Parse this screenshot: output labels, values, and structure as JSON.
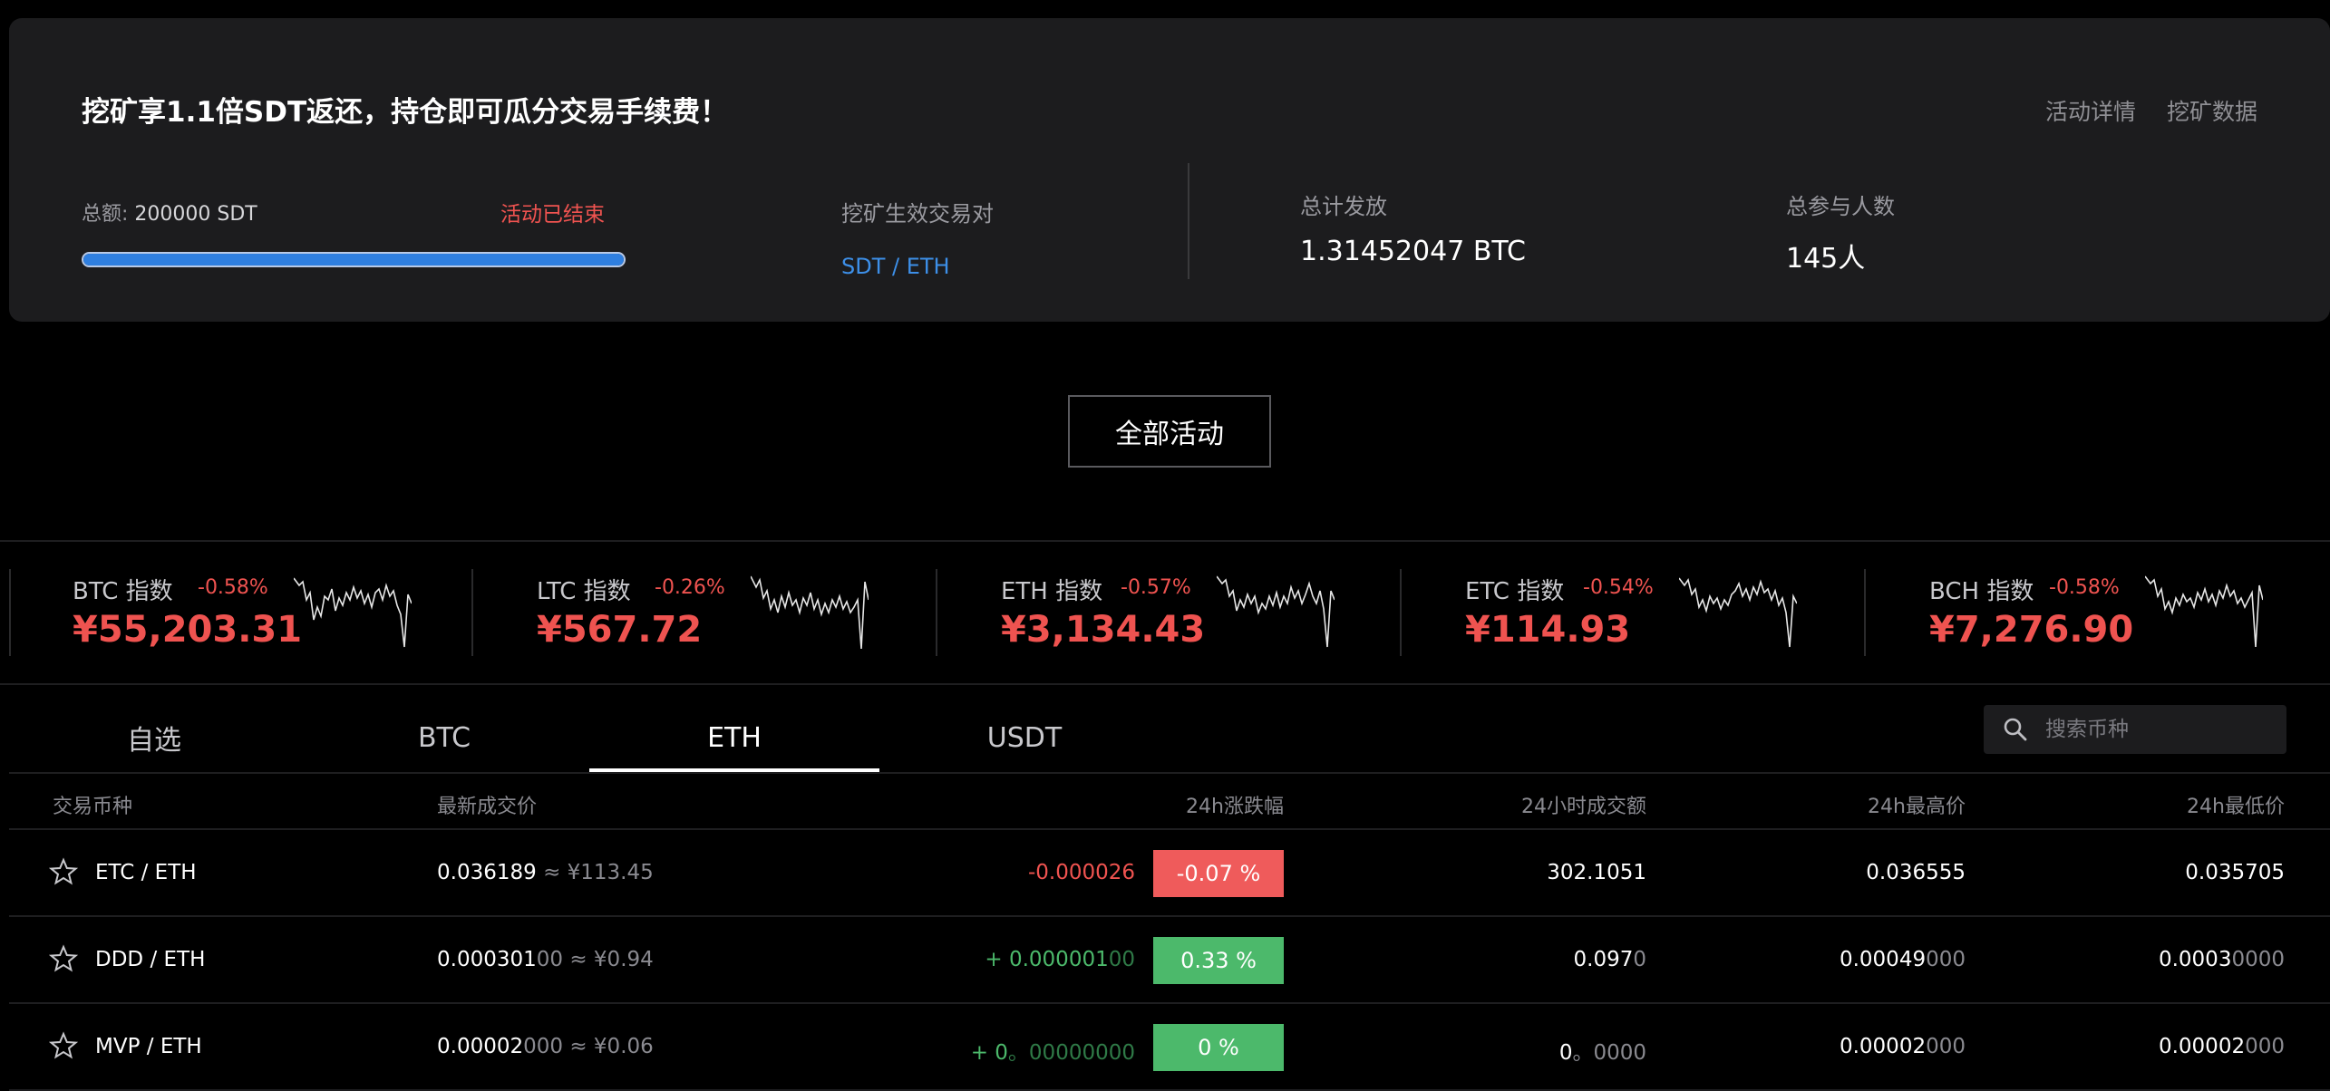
{
  "activity": {
    "title": "挖矿享1.1倍SDT返还，持仓即可瓜分交易手续费！",
    "links": [
      "活动详情",
      "挖矿数据"
    ],
    "total_label": "总额:",
    "total_value": "200000 SDT",
    "status": "活动已结束",
    "progress": 1.0,
    "pair_label": "挖矿生效交易对",
    "pair_value": "SDT / ETH",
    "distributed_label": "总计发放",
    "distributed_value": "1.31452047 BTC",
    "participants_label": "总参与人数",
    "participants_value": "145人"
  },
  "all_activities_button": "全部活动",
  "indices": [
    {
      "name": "BTC 指数",
      "change": "-0.58%",
      "price": "¥55,203.31"
    },
    {
      "name": "LTC 指数",
      "change": "-0.26%",
      "price": "¥567.72"
    },
    {
      "name": "ETH 指数",
      "change": "-0.57%",
      "price": "¥3,134.43"
    },
    {
      "name": "ETC 指数",
      "change": "-0.54%",
      "price": "¥114.93"
    },
    {
      "name": "BCH 指数",
      "change": "-0.58%",
      "price": "¥7,276.90"
    }
  ],
  "tabs": [
    "自选",
    "BTC",
    "ETH",
    "USDT"
  ],
  "active_tab": "ETH",
  "search": {
    "placeholder": "搜索币种"
  },
  "table": {
    "headers": [
      "交易币种",
      "最新成交价",
      "24h涨跌幅",
      "24小时成交额",
      "24h最高价",
      "24h最低价"
    ],
    "rows": [
      {
        "pair": "ETC / ETH",
        "price": "0.036189",
        "price_tail": "",
        "price_cny": "≈ ¥113.45",
        "change_abs": "-0.000026",
        "change_abs_tail": "",
        "change_pct": "-0.07 %",
        "direction": "down",
        "volume": "302.1051",
        "volume_tail": "",
        "high": "0.036555",
        "high_tail": "",
        "low": "0.035705",
        "low_tail": ""
      },
      {
        "pair": "DDD / ETH",
        "price": "0.000301",
        "price_tail": "00",
        "price_cny": "≈ ¥0.94",
        "change_abs": "+ 0.000001",
        "change_abs_tail": "00",
        "change_pct": "0.33 %",
        "direction": "up",
        "volume": "0.097",
        "volume_tail": "0",
        "high": "0.00049",
        "high_tail": "000",
        "low": "0.0003",
        "low_tail": "0000"
      },
      {
        "pair": "MVP / ETH",
        "price": "0.00002",
        "price_tail": "000",
        "price_cny": "≈ ¥0.06",
        "change_abs": "+ 0",
        "change_abs_tail": "。00000000",
        "change_pct": "0 %",
        "direction": "up",
        "volume": "0",
        "volume_tail": "。0000",
        "high": "0.00002",
        "high_tail": "000",
        "low": "0.00002",
        "low_tail": "000"
      }
    ]
  },
  "colors": {
    "up": "#4cb96b",
    "down": "#ef5350",
    "accent": "#2f7fe0"
  }
}
